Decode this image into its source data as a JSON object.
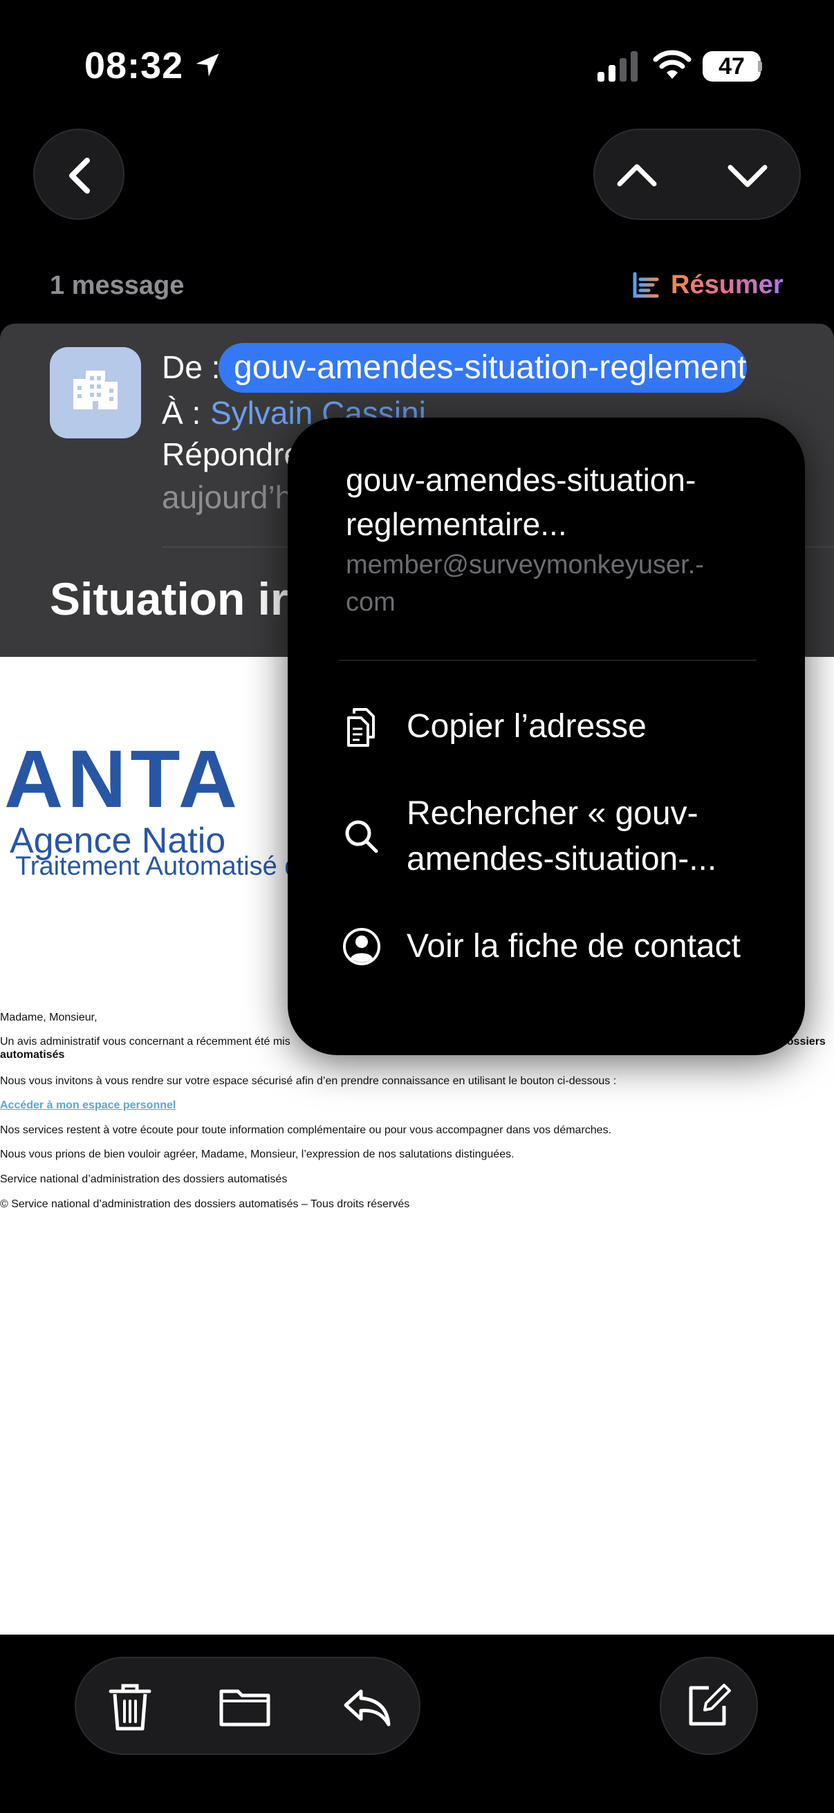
{
  "status_bar": {
    "time": "08:32",
    "battery": "47"
  },
  "thread": {
    "count_label": "1 message",
    "summarize_label": "Résumer"
  },
  "header": {
    "from_label": "De :",
    "from_value": "gouv-amendes-situation-reglementaire",
    "to_label": "À :",
    "to_value": "Sylvain Cassini",
    "reply_label": "Répondre",
    "date_label": "aujourd’h",
    "subject": "Situation irr"
  },
  "email_body": {
    "logo_big": "ANTA",
    "logo_line2": "Agence  Natio",
    "logo_line3": "Traitement Automatisé des Inf",
    "greeting": "Madame, Monsieur,",
    "para1_start": "Un avis administratif vous concernant a récemment été mis",
    "para1_end": "dossiers",
    "para1_cont": "automatisés",
    "para2": "Nous vous invitons à vous rendre sur votre espace sécurisé afin d’en prendre connaissance en utilisant le bouton ci-dessous :",
    "link": "Accéder à mon espace personnel",
    "para3": "Nos services restent à votre écoute pour toute information complémentaire ou pour vous accompagner dans vos démarches.",
    "para4": "Nous vous prions de bien vouloir agréer, Madame, Monsieur, l’expression de nos salutations distinguées.",
    "signature": "Service national d’administration des dossiers automatisés",
    "footer": "© Service national d’administration des dossiers automatisés – Tous droits réservés"
  },
  "popup": {
    "sender_name": "gouv-amendes-situation-reglementaire...",
    "sender_email": "member@surveymonkeyuser.-com",
    "actions": [
      {
        "icon": "copy-icon",
        "label": "Copier l’adresse"
      },
      {
        "icon": "search-icon",
        "label": "Rechercher « gouv-amendes-situation-..."
      },
      {
        "icon": "contact-icon",
        "label": "Voir la fiche de contact"
      }
    ]
  },
  "toolbar": {
    "icons": [
      "trash-icon",
      "folder-icon",
      "reply-icon",
      "compose-icon"
    ]
  },
  "colors": {
    "accent": "#3478f6",
    "link": "#6aa0f0",
    "logo": "#2756a5"
  }
}
